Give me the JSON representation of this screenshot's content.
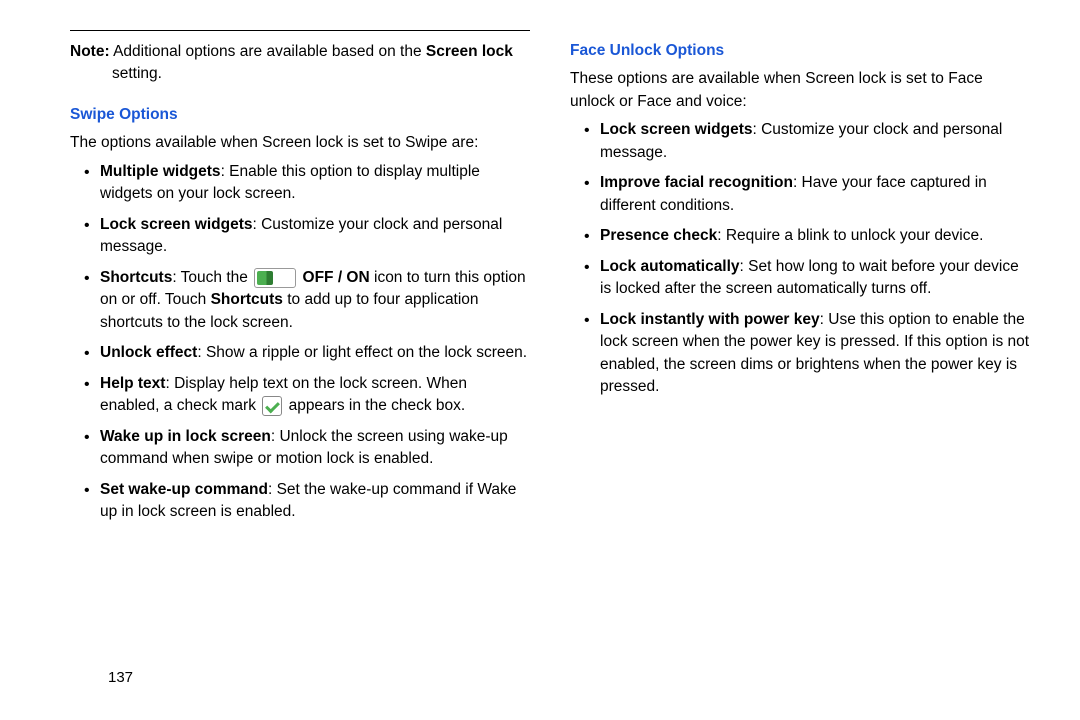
{
  "note": {
    "label": "Note:",
    "text_before": "Additional options are available based on the ",
    "bold": "Screen lock",
    "text_after": " setting."
  },
  "left": {
    "heading": "Swipe Options",
    "intro": "The options available when Screen lock is set to Swipe are:",
    "items": {
      "multiple_widgets": {
        "title": "Multiple widgets",
        "desc": ": Enable this option to display multiple widgets on your lock screen."
      },
      "lock_widgets": {
        "title": "Lock screen widgets",
        "desc": ": Customize your clock and personal message."
      },
      "shortcuts": {
        "title": "Shortcuts",
        "pre": ": Touch the ",
        "off_on": "OFF / ON",
        "mid": " icon to turn this option on or off. Touch ",
        "shortcuts_bold": "Shortcuts",
        "post": " to add up to four application shortcuts to the lock screen."
      },
      "unlock_effect": {
        "title": "Unlock effect",
        "desc": ": Show a ripple or light effect on the lock screen."
      },
      "help_text": {
        "title": "Help text",
        "pre": ": Display help text on the lock screen. When enabled, a check mark ",
        "post": " appears in the check box."
      },
      "wake_up": {
        "title": "Wake up in lock screen",
        "desc": ": Unlock the screen using wake-up command when swipe or motion lock is enabled."
      },
      "set_wake": {
        "title": "Set wake-up command",
        "desc": ": Set the wake-up command if Wake up in lock screen is enabled."
      }
    }
  },
  "right": {
    "heading": "Face Unlock Options",
    "intro": "These options are available when Screen lock is set to Face unlock or Face and voice:",
    "items": {
      "lock_widgets": {
        "title": "Lock screen widgets",
        "desc": ": Customize your clock and personal message."
      },
      "improve": {
        "title": "Improve facial recognition",
        "desc": ": Have your face captured in different conditions."
      },
      "presence": {
        "title": "Presence check",
        "desc": ": Require a blink to unlock your device."
      },
      "lock_auto": {
        "title": "Lock automatically",
        "desc": ": Set how long to wait before your device is locked after the screen automatically turns off."
      },
      "lock_power": {
        "title": "Lock instantly with power key",
        "desc": ": Use this option to enable the lock screen when the power key is pressed. If this option is not enabled, the screen dims or brightens when the power key is pressed."
      }
    }
  },
  "page_number": "137"
}
